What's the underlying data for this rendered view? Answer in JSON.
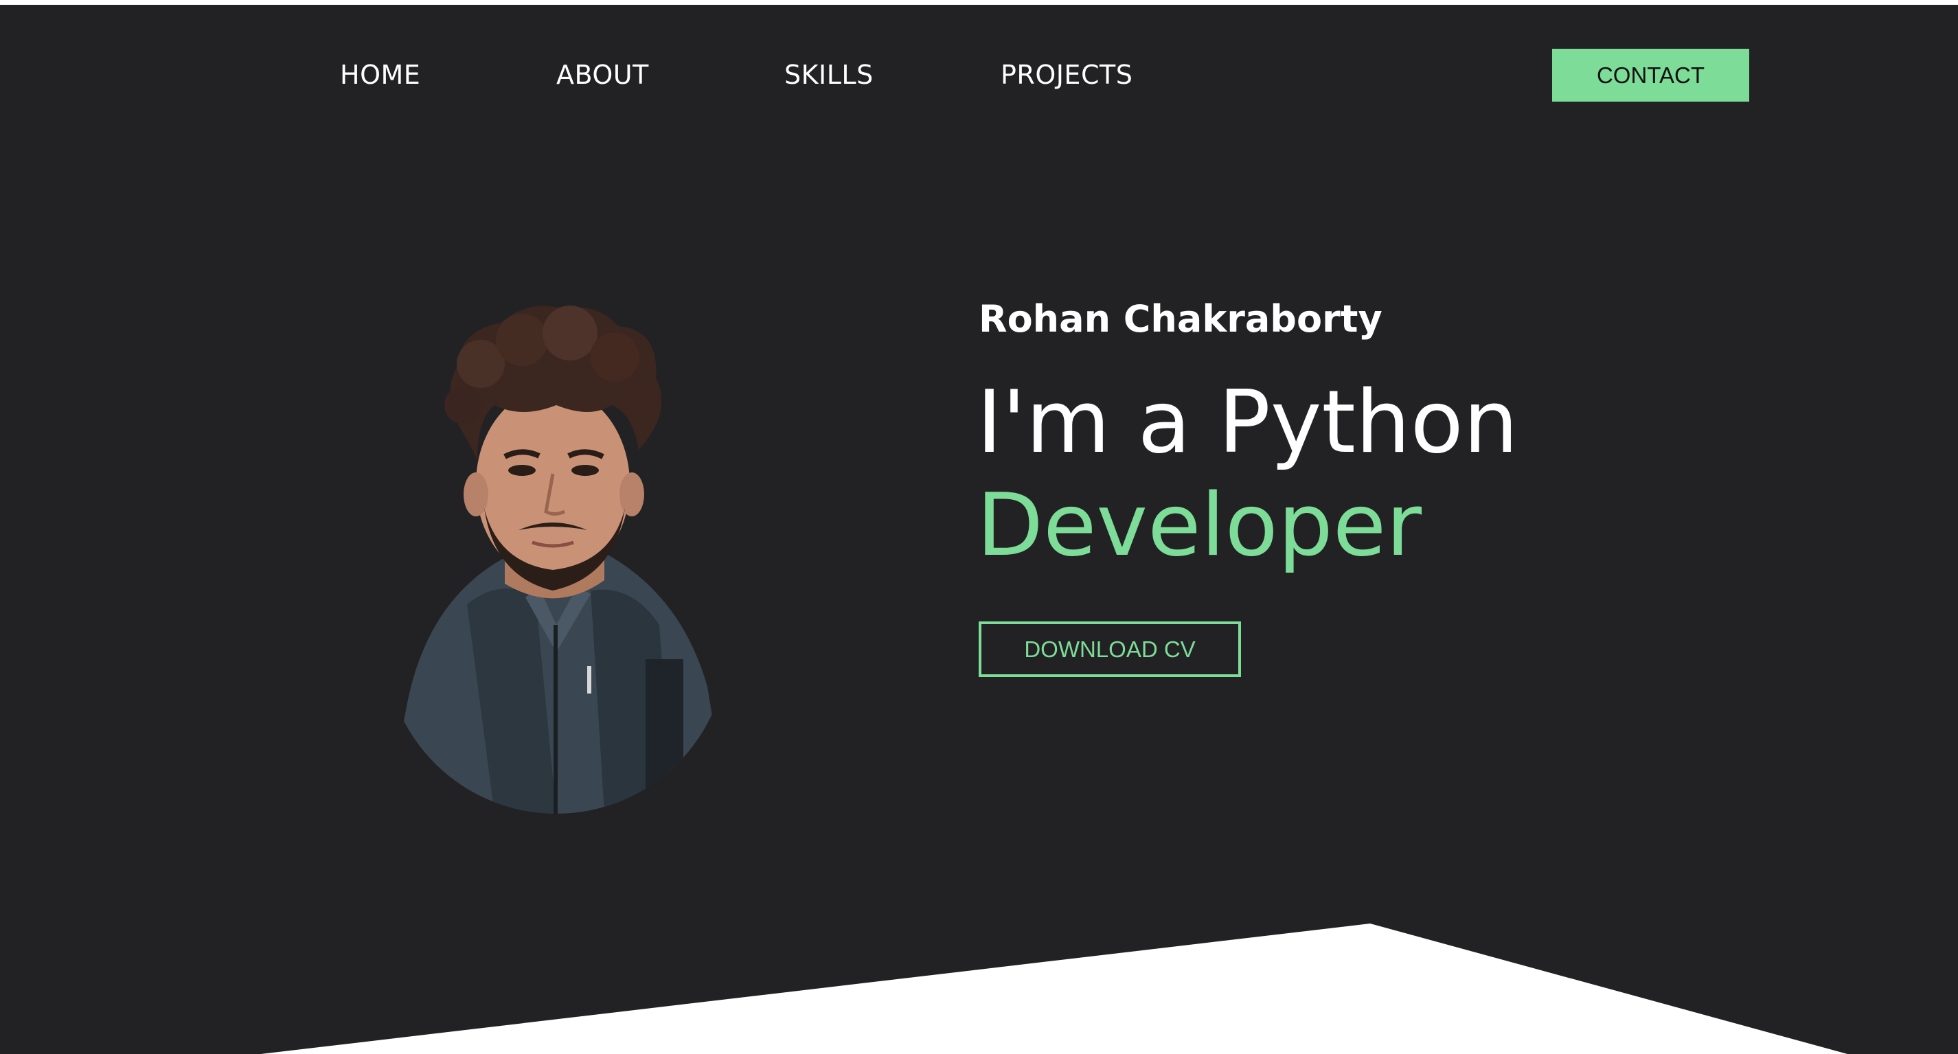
{
  "nav": {
    "items": [
      {
        "label": "HOME"
      },
      {
        "label": "ABOUT"
      },
      {
        "label": "SKILLS"
      },
      {
        "label": "PROJECTS"
      }
    ],
    "contact_label": "CONTACT"
  },
  "hero": {
    "name": "Rohan Chakraborty",
    "headline": "I'm a Python",
    "role": "Developer",
    "cv_button_label": "DOWNLOAD CV",
    "avatar_icon": "profile-photo"
  },
  "colors": {
    "background": "#222224",
    "accent": "#7ddc98",
    "text": "#ffffff",
    "footer_shape": "#ffffff"
  }
}
